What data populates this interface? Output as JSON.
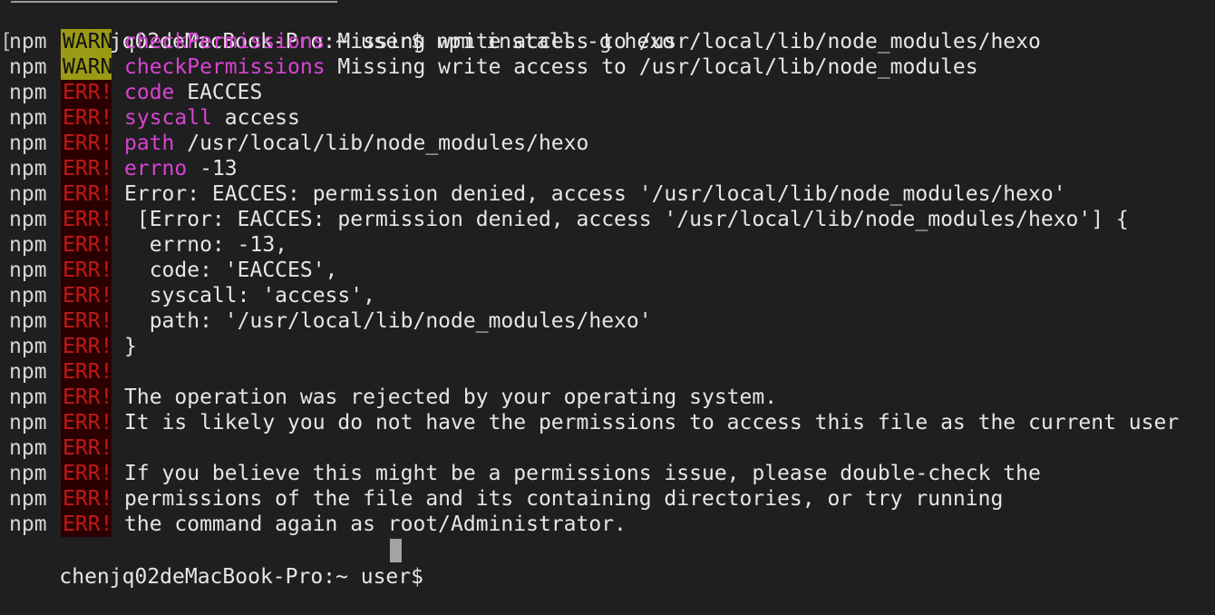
{
  "terminal": {
    "prompt_host": "chenjq02deMacBook-Pro:~ user$",
    "command": "npm install -g hexo",
    "lines": [
      {
        "prefix": "npm",
        "level": "WARN",
        "key": "checkPermissions",
        "text": " Missing write access to /usr/local/lib/node_modules/hexo"
      },
      {
        "prefix": "npm",
        "level": "WARN",
        "key": "checkPermissions",
        "text": " Missing write access to /usr/local/lib/node_modules"
      },
      {
        "prefix": "npm",
        "level": "ERR!",
        "key": "code",
        "text": " EACCES"
      },
      {
        "prefix": "npm",
        "level": "ERR!",
        "key": "syscall",
        "text": " access"
      },
      {
        "prefix": "npm",
        "level": "ERR!",
        "key": "path",
        "text": " /usr/local/lib/node_modules/hexo"
      },
      {
        "prefix": "npm",
        "level": "ERR!",
        "key": "errno",
        "text": " -13"
      },
      {
        "prefix": "npm",
        "level": "ERR!",
        "key": "",
        "text": "Error: EACCES: permission denied, access '/usr/local/lib/node_modules/hexo'"
      },
      {
        "prefix": "npm",
        "level": "ERR!",
        "key": "",
        "text": " [Error: EACCES: permission denied, access '/usr/local/lib/node_modules/hexo'] {"
      },
      {
        "prefix": "npm",
        "level": "ERR!",
        "key": "",
        "text": "  errno: -13,"
      },
      {
        "prefix": "npm",
        "level": "ERR!",
        "key": "",
        "text": "  code: 'EACCES',"
      },
      {
        "prefix": "npm",
        "level": "ERR!",
        "key": "",
        "text": "  syscall: 'access',"
      },
      {
        "prefix": "npm",
        "level": "ERR!",
        "key": "",
        "text": "  path: '/usr/local/lib/node_modules/hexo'"
      },
      {
        "prefix": "npm",
        "level": "ERR!",
        "key": "",
        "text": "}"
      },
      {
        "prefix": "npm",
        "level": "ERR!",
        "key": "",
        "text": ""
      },
      {
        "prefix": "npm",
        "level": "ERR!",
        "key": "",
        "text": "The operation was rejected by your operating system."
      },
      {
        "prefix": "npm",
        "level": "ERR!",
        "key": "",
        "text": "It is likely you do not have the permissions to access this file as the current user"
      },
      {
        "prefix": "npm",
        "level": "ERR!",
        "key": "",
        "text": ""
      },
      {
        "prefix": "npm",
        "level": "ERR!",
        "key": "",
        "text": "If you believe this might be a permissions issue, please double-check the"
      },
      {
        "prefix": "npm",
        "level": "ERR!",
        "key": "",
        "text": "permissions of the file and its containing directories, or try running"
      },
      {
        "prefix": "npm",
        "level": "ERR!",
        "key": "",
        "text": "the command again as root/Administrator."
      }
    ],
    "final_prompt": "chenjq02deMacBook-Pro:~ user$",
    "colors": {
      "background": "#1f1f1f",
      "foreground": "#e6e6e6",
      "warn_bg": "#9b9a15",
      "err_fg": "#c21818",
      "key_fg": "#d943d4",
      "cursor": "#a3a3a3"
    }
  }
}
